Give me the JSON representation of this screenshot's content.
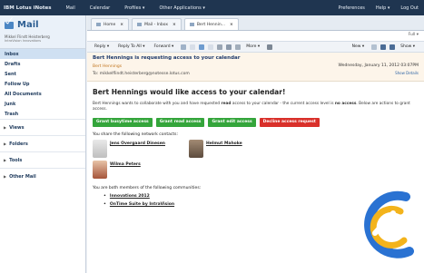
{
  "app": {
    "brand": "IBM Lotus iNotes"
  },
  "topnav": {
    "items": [
      "Mail",
      "Calendar",
      "Profiles ▾",
      "Other Applications ▾"
    ],
    "right": [
      "Preferences",
      "Help ▾",
      "Log Out"
    ]
  },
  "sidebar": {
    "title": "Mail",
    "user": "Mikkel Flindt Heisterberg",
    "user_org": "IntraVision Innovations",
    "items": [
      "Inbox",
      "Drafts",
      "Sent",
      "Follow Up",
      "All Documents",
      "Junk",
      "Trash"
    ],
    "sections": [
      "Views",
      "Folders",
      "Tools",
      "Other Mail"
    ]
  },
  "tabs": [
    {
      "label": "Home"
    },
    {
      "label": "Mail - Inbox"
    },
    {
      "label": "Bert Hennin..."
    }
  ],
  "follow_label": "Full ▾",
  "toolbar": {
    "reply": "Reply ▾",
    "reply_all": "Reply To All ▾",
    "forward": "Forward ▾",
    "more": "More ▾",
    "new": "New ▾",
    "show": "Show ▾"
  },
  "message": {
    "subject": "Bert Hennings is requesting access to your calendar",
    "from": "Bert Hennings",
    "to_label": "To:",
    "to": "mikkelflindt.heisterberg@notesse.lotus.com",
    "date": "Wednesday, January 11, 2012 03:07PM",
    "show_details": "Show Details"
  },
  "content": {
    "headline": "Bert Hennings would like access to your calendar!",
    "desc_pre": "Bert Hennings wants to collaborate with you and have requested ",
    "desc_read": "read",
    "desc_mid": " access to your calendar - the current access level is ",
    "desc_noaccess": "no access",
    "desc_post": ". Below are actions to grant access.",
    "buttons": [
      "Grant busytime access",
      "Grant read access",
      "Grant edit access",
      "Decline access request"
    ],
    "share_label": "You share the following network contacts:",
    "contacts": [
      "Jens Overgaard Dinesen",
      "Helmut Mahoke",
      "Wilma Peters"
    ],
    "members_label": "You are both members of the following communities:",
    "communities": [
      "Innovations 2012",
      "OnTime Suite by IntraVision"
    ]
  },
  "colors": {
    "topbar": "#1f3550",
    "accent": "#2d5e92",
    "green": "#34a53b",
    "red": "#d9302a"
  }
}
